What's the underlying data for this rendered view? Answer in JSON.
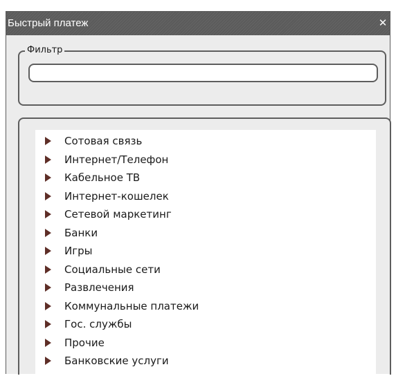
{
  "window": {
    "title": "Быстрый платеж",
    "close_glyph": "✕"
  },
  "filter": {
    "legend": "Фильтр",
    "value": "",
    "placeholder": ""
  },
  "categories": {
    "items": [
      {
        "label": "Сотовая связь",
        "icon": "expand-arrow-icon"
      },
      {
        "label": "Интернет/Телефон",
        "icon": "expand-arrow-icon"
      },
      {
        "label": "Кабельное ТВ",
        "icon": "expand-arrow-icon"
      },
      {
        "label": "Интернет-кошелек",
        "icon": "expand-arrow-icon"
      },
      {
        "label": "Сетевой маркетинг",
        "icon": "expand-arrow-icon"
      },
      {
        "label": "Банки",
        "icon": "expand-arrow-icon"
      },
      {
        "label": "Игры",
        "icon": "expand-arrow-icon"
      },
      {
        "label": "Социальные сети",
        "icon": "expand-arrow-icon"
      },
      {
        "label": "Развлечения",
        "icon": "expand-arrow-icon"
      },
      {
        "label": "Коммунальные платежи",
        "icon": "expand-arrow-icon"
      },
      {
        "label": "Гос. службы",
        "icon": "expand-arrow-icon"
      },
      {
        "label": "Прочие",
        "icon": "expand-arrow-icon"
      },
      {
        "label": "Банковские услуги",
        "icon": "expand-arrow-icon"
      }
    ]
  },
  "colors": {
    "titlebar": "#5b5b5b",
    "arrow": "#5e2e27",
    "window_background": "#ececec"
  }
}
